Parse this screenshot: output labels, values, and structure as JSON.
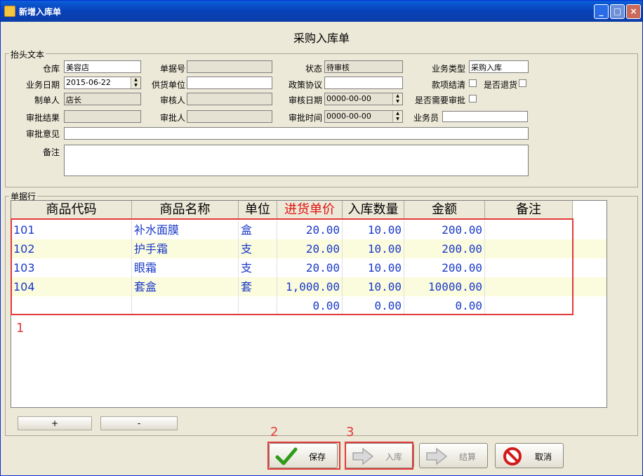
{
  "window": {
    "title": "新增入库单"
  },
  "form": {
    "title": "采购入库单"
  },
  "header_group": {
    "label": "抬头文本"
  },
  "fields": {
    "warehouse": {
      "label": "仓库",
      "value": "美容店"
    },
    "doc_no": {
      "label": "单据号",
      "value": ""
    },
    "status": {
      "label": "状态",
      "value": "待审核"
    },
    "biz_type": {
      "label": "业务类型",
      "value": "采购入库"
    },
    "biz_date": {
      "label": "业务日期",
      "value": "2015-06-22"
    },
    "supplier": {
      "label": "供货单位",
      "value": ""
    },
    "policy": {
      "label": "政策协议",
      "value": ""
    },
    "settled": {
      "label": "款项结清"
    },
    "returned": {
      "label": "是否退货"
    },
    "creator": {
      "label": "制单人",
      "value": "店长"
    },
    "reviewer": {
      "label": "审核人",
      "value": ""
    },
    "review_date": {
      "label": "审核日期",
      "value": "0000-00-00"
    },
    "need_approval": {
      "label": "是否需要审批"
    },
    "approve_result": {
      "label": "审批结果",
      "value": ""
    },
    "approver": {
      "label": "审批人",
      "value": ""
    },
    "approve_time": {
      "label": "审批时间",
      "value": "0000-00-00"
    },
    "salesman": {
      "label": "业务员",
      "value": ""
    },
    "approve_opinion": {
      "label": "审批意见",
      "value": ""
    },
    "remark": {
      "label": "备注",
      "value": ""
    }
  },
  "lines_group": {
    "label": "单据行"
  },
  "grid": {
    "columns": [
      "商品代码",
      "商品名称",
      "单位",
      "进货单价",
      "入库数量",
      "金额",
      "备注"
    ],
    "rows": [
      {
        "code": "101",
        "name": "补水面膜",
        "unit": "盒",
        "price": "20.00",
        "qty": "10.00",
        "amount": "200.00",
        "note": ""
      },
      {
        "code": "102",
        "name": "护手霜",
        "unit": "支",
        "price": "20.00",
        "qty": "10.00",
        "amount": "200.00",
        "note": ""
      },
      {
        "code": "103",
        "name": "眼霜",
        "unit": "支",
        "price": "20.00",
        "qty": "10.00",
        "amount": "200.00",
        "note": ""
      },
      {
        "code": "104",
        "name": "套盒",
        "unit": "套",
        "price": "1,000.00",
        "qty": "10.00",
        "amount": "10000.00",
        "note": ""
      },
      {
        "code": "",
        "name": "",
        "unit": "",
        "price": "0.00",
        "qty": "0.00",
        "amount": "0.00",
        "note": ""
      }
    ]
  },
  "annotations": [
    "1",
    "2",
    "3"
  ],
  "row_buttons": {
    "add": "+",
    "remove": "-"
  },
  "actions": {
    "save": "保存",
    "stock_in": "入库",
    "settle": "结算",
    "cancel": "取消"
  },
  "colors": {
    "highlight_red": "#e23a3a",
    "grid_text": "#1a3ac8",
    "price_header": "#e01010"
  }
}
